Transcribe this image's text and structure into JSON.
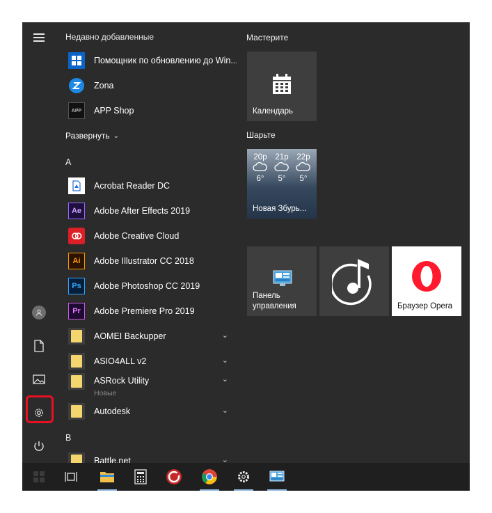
{
  "recent_header": "Недавно добавленные",
  "recent_apps": [
    {
      "label": "Помощник по обновлению до Win..."
    },
    {
      "label": "Zona"
    },
    {
      "label": "APP Shop",
      "icon_text": "APP"
    }
  ],
  "expand_label": "Развернуть",
  "letter_a": "A",
  "letter_b": "B",
  "apps_a": [
    {
      "label": "Acrobat Reader DC"
    },
    {
      "label": "Adobe After Effects 2019",
      "icon_text": "Ae"
    },
    {
      "label": "Adobe Creative Cloud"
    },
    {
      "label": "Adobe Illustrator CC 2018",
      "icon_text": "Ai"
    },
    {
      "label": "Adobe Photoshop CC 2019",
      "icon_text": "Ps"
    },
    {
      "label": "Adobe Premiere Pro 2019",
      "icon_text": "Pr"
    }
  ],
  "folders": [
    {
      "label": "AOMEI Backupper"
    },
    {
      "label": "ASIO4ALL v2"
    },
    {
      "label": "ASRock Utility",
      "sub": "Новые"
    },
    {
      "label": "Autodesk"
    }
  ],
  "apps_b": [
    {
      "label": "Battle.net"
    }
  ],
  "tiles": {
    "group1": "Мастерите",
    "calendar": "Календарь",
    "group2": "Шарьте",
    "weather": {
      "location": "Новая Збурь...",
      "forecast": [
        {
          "time": "20р",
          "temp": "6°"
        },
        {
          "time": "21р",
          "temp": "5°"
        },
        {
          "time": "22р",
          "temp": "5°"
        }
      ]
    },
    "control_panel": "Панель управления",
    "opera": "Браузер Opera"
  },
  "rail_icons": [
    "menu-icon",
    "user-icon",
    "documents-icon",
    "pictures-icon",
    "settings-icon",
    "power-icon"
  ],
  "taskbar_icons": [
    "windows-start-icon",
    "task-view-icon",
    "file-explorer-icon",
    "calculator-icon",
    "cc-cleaner-icon",
    "chrome-icon",
    "settings-icon",
    "control-panel-icon"
  ],
  "colors": {
    "menu_bg": "#2b2b2b",
    "tile_bg": "#3e3e3e",
    "highlight": "#e81123",
    "opera_red": "#ff1b2d"
  }
}
